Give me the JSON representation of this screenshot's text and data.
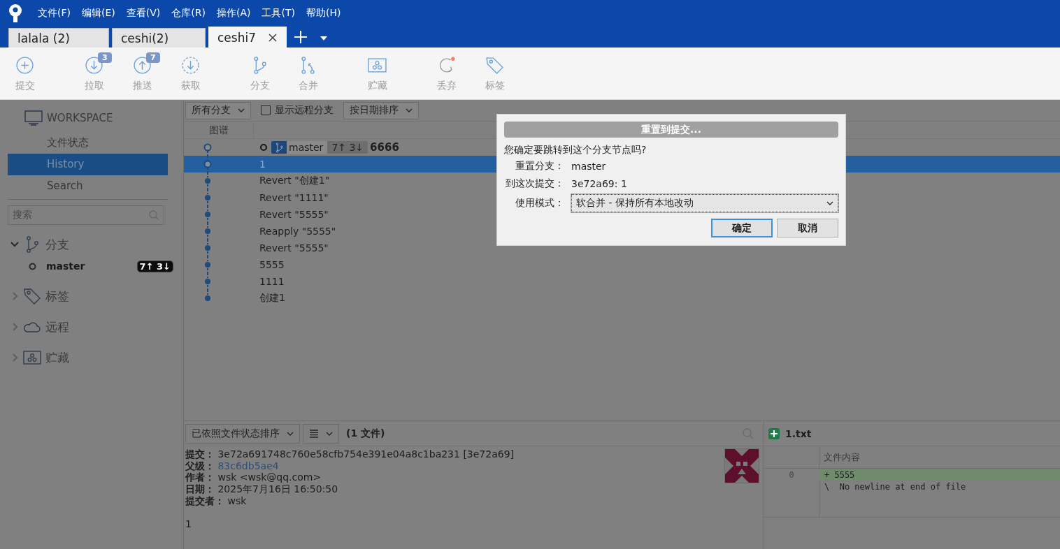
{
  "menu": [
    "文件(F)",
    "编辑(E)",
    "查看(V)",
    "仓库(R)",
    "操作(A)",
    "工具(T)",
    "帮助(H)"
  ],
  "repo_tabs": [
    {
      "label": "lalala (2)",
      "selected": false
    },
    {
      "label": "ceshi(2)",
      "selected": false
    },
    {
      "label": "ceshi7",
      "selected": true
    }
  ],
  "toolbar": [
    [
      {
        "label": "提交",
        "kind": "commit"
      }
    ],
    [
      {
        "label": "拉取",
        "kind": "pull",
        "badge": "3"
      },
      {
        "label": "推送",
        "kind": "push",
        "badge": "7"
      },
      {
        "label": "获取",
        "kind": "fetch"
      }
    ],
    [
      {
        "label": "分支",
        "kind": "branch"
      },
      {
        "label": "合并",
        "kind": "merge"
      }
    ],
    [
      {
        "label": "贮藏",
        "kind": "stash"
      }
    ],
    [
      {
        "label": "丢弃",
        "kind": "discard"
      },
      {
        "label": "标签",
        "kind": "tag"
      }
    ]
  ],
  "sidebar": {
    "workspace": "WORKSPACE",
    "items": [
      {
        "label": "文件状态",
        "selected": false
      },
      {
        "label": "History",
        "selected": true
      },
      {
        "label": "Search",
        "selected": false
      }
    ],
    "search": {
      "placeholder": "搜索"
    },
    "sections": [
      {
        "label": "分支",
        "kind": "branch",
        "expanded": true,
        "children": [
          {
            "label": "master",
            "counts": "7↑ 3↓"
          }
        ]
      },
      {
        "label": "标签",
        "kind": "tag",
        "expanded": false
      },
      {
        "label": "远程",
        "kind": "cloud",
        "expanded": false
      },
      {
        "label": "贮藏",
        "kind": "stash",
        "expanded": false
      }
    ]
  },
  "filters": {
    "branches": "所有分支",
    "show_remote": {
      "label": "显示远程分支",
      "checked": false
    },
    "sort": "按日期排序"
  },
  "graph": {
    "column": "图谱",
    "commits": [
      {
        "message": "6666",
        "kind": "hollow",
        "selected": false,
        "branch": "master",
        "counts": "7↑ 3↓"
      },
      {
        "message": "1",
        "kind": "hollow",
        "selected": true
      },
      {
        "message": "Revert \"创建1\"",
        "kind": "dot",
        "selected": false
      },
      {
        "message": "Revert \"1111\"",
        "kind": "dot",
        "selected": false
      },
      {
        "message": "Revert \"5555\"",
        "kind": "dot",
        "selected": false
      },
      {
        "message": "Reapply \"5555\"",
        "kind": "dot",
        "selected": false
      },
      {
        "message": "Revert \"5555\"",
        "kind": "dot",
        "selected": false
      },
      {
        "message": "5555",
        "kind": "dot",
        "selected": false
      },
      {
        "message": "1111",
        "kind": "dot",
        "selected": false
      },
      {
        "message": "创建1",
        "kind": "dot",
        "selected": false
      }
    ]
  },
  "details": {
    "sort": "已依照文件状态排序",
    "file_count": "(1 文件)",
    "fields": [
      {
        "label": "提交：",
        "value": "3e72a691748c760e58cfb754e391e04a8c1ba231 [3e72a69]",
        "kind": "text"
      },
      {
        "label": "父级：",
        "value": "83c6db5ae4",
        "kind": "link"
      },
      {
        "label": "作者：",
        "value": "wsk <wsk@qq.com>",
        "kind": "text"
      },
      {
        "label": "日期：",
        "value": "2025年7月16日 16:50:50",
        "kind": "text"
      },
      {
        "label": "提交者：",
        "value": "wsk",
        "kind": "text"
      }
    ],
    "message": "1"
  },
  "diff": {
    "file": "1.txt",
    "column": "文件内容",
    "lines": [
      {
        "number": "0",
        "text": "+ 5555",
        "kind": "added"
      },
      {
        "text": "\\  No newline at end of file",
        "kind": "context"
      }
    ]
  },
  "dialog": {
    "title": "重置到提交...",
    "question": "您确定要跳转到这个分支节点吗?",
    "fields": [
      {
        "label": "重置分支：",
        "value": "master"
      },
      {
        "label": "到这次提交：",
        "value": "3e72a69: 1"
      }
    ],
    "mode": {
      "label": "使用模式：",
      "value": "软合并 - 保持所有本地改动"
    },
    "buttons": [
      {
        "label": "确定",
        "default": true
      },
      {
        "label": "取消",
        "default": false
      }
    ]
  }
}
